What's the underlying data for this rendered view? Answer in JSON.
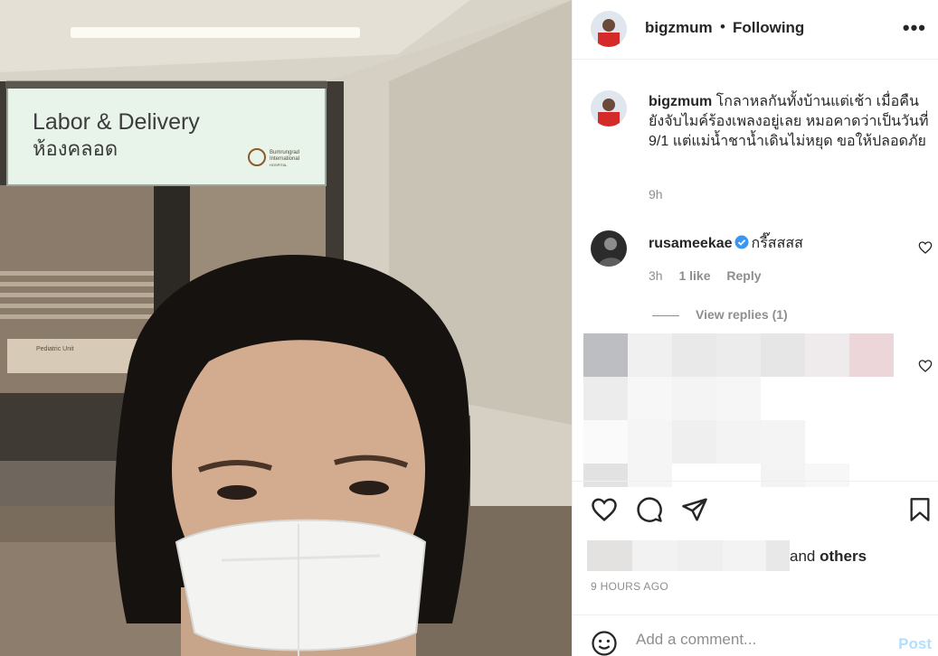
{
  "photo": {
    "sign_line1": "Labor & Delivery",
    "sign_line2": "ห้องคลอด",
    "logo_line1": "Bumrungrad",
    "logo_line2": "International",
    "logo_line3": "HOSPITAL",
    "door_sign_title": "Pediatric Unit"
  },
  "header": {
    "username": "bigzmum",
    "separator": "•",
    "follow_status": "Following",
    "more_icon": "more-horizontal-icon"
  },
  "caption": {
    "username": "bigzmum",
    "text": "โกลาหลกันทั้งบ้านแต่เช้า เมื่อคืนยังจับไมค์ร้องเพลงอยู่เลย หมอคาดว่าเป็นวันที่ 9/1 แต่แม่น้ำชาน้ำเดินไม่หยุด ขอให้ปลอดภัย",
    "time": "9h"
  },
  "comments": [
    {
      "username": "rusameekae",
      "verified": true,
      "text": "กรี๊สสสส",
      "time": "3h",
      "likes": "1 like",
      "reply_label": "Reply",
      "view_replies": "View replies (1)"
    }
  ],
  "actions": {
    "like_icon": "heart-icon",
    "comment_icon": "comment-icon",
    "share_icon": "send-icon",
    "save_icon": "bookmark-icon"
  },
  "likes": {
    "and_text": "and",
    "others_text": "others"
  },
  "post_time": "9 HOURS AGO",
  "add_comment": {
    "placeholder": "Add a comment...",
    "post_label": "Post",
    "emoji_icon": "smile-icon"
  },
  "colors": {
    "link_blue": "#b2dffc",
    "verified_blue": "#3897f0",
    "secondary_text": "#8e8e8e"
  }
}
